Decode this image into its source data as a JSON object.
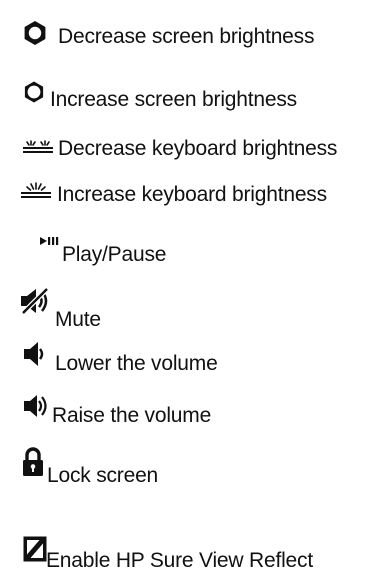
{
  "items": [
    {
      "icon": "brightness-down-icon",
      "label": "Decrease screen brightness"
    },
    {
      "icon": "brightness-up-icon",
      "label": "Increase screen brightness"
    },
    {
      "icon": "keyboard-backlight-down-icon",
      "label": "Decrease keyboard brightness"
    },
    {
      "icon": "keyboard-backlight-up-icon",
      "label": "Increase keyboard brightness"
    },
    {
      "icon": "play-pause-icon",
      "label": "Play/Pause"
    },
    {
      "icon": "mute-icon",
      "label": "Mute"
    },
    {
      "icon": "volume-down-icon",
      "label": "Lower the volume"
    },
    {
      "icon": "volume-up-icon",
      "label": "Raise the volume"
    },
    {
      "icon": "lock-icon",
      "label": "Lock screen"
    },
    {
      "icon": "privacy-screen-icon",
      "label": "Enable HP Sure View Reflect"
    }
  ]
}
